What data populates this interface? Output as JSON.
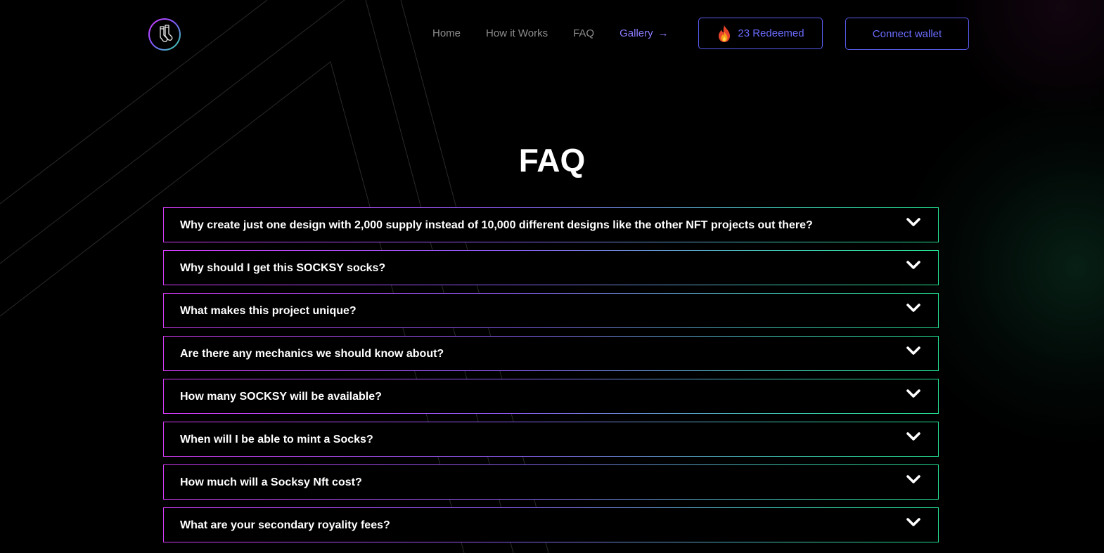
{
  "colors": {
    "background": "#000000",
    "accent_blue": "#6a6cff",
    "gradient_pink": "#d43af7",
    "gradient_green": "#23e08f",
    "nav_gray": "#8d8d8d"
  },
  "header": {
    "logo_icon": "socks-logo-icon",
    "nav": {
      "home": "Home",
      "how_it_works": "How it Works",
      "faq": "FAQ",
      "gallery": "Gallery",
      "gallery_arrow": "→"
    },
    "redeemed_icon": "fire-icon",
    "redeemed_label": "23 Redeemed",
    "connect_wallet_label": "Connect wallet"
  },
  "main": {
    "title": "FAQ",
    "faq_items": [
      {
        "question": "Why create just one design with 2,000 supply instead of 10,000 different designs like the other NFT projects out there?"
      },
      {
        "question": "Why should I get this SOCKSY socks?"
      },
      {
        "question": "What makes this project unique?"
      },
      {
        "question": "Are there any mechanics we should know about?"
      },
      {
        "question": "How many SOCKSY will be available?"
      },
      {
        "question": "When will I be able to mint a Socks?"
      },
      {
        "question": "How much will a Socksy Nft cost?"
      },
      {
        "question": "What are your secondary royality fees?"
      }
    ],
    "chevron_icon": "chevron-down-icon"
  }
}
